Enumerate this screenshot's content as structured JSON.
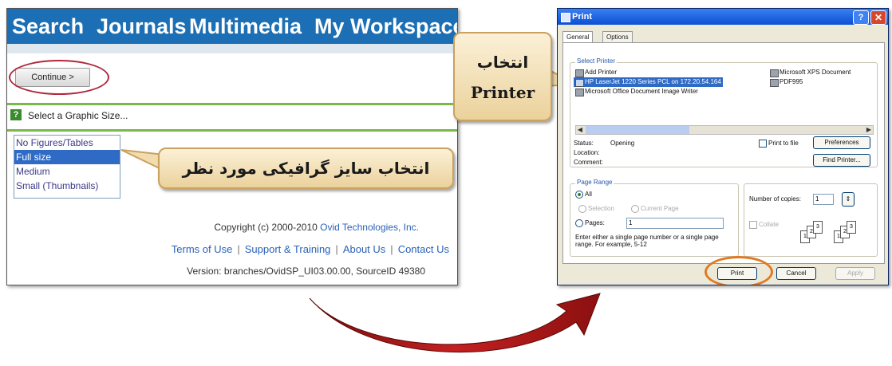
{
  "left_panel": {
    "nav": [
      "Search",
      "Journals",
      "Multimedia",
      "My Workspace"
    ],
    "continue_label": "Continue >",
    "size_prompt": "Select a Graphic Size...",
    "size_options": [
      "No Figures/Tables",
      "Full size",
      "Medium",
      "Small (Thumbnails)"
    ],
    "selected_size_index": 1,
    "footer": {
      "copyright_prefix": "Copyright (c) 2000-2010 ",
      "copyright_company": "Ovid Technologies, Inc.",
      "links": [
        "Terms of Use",
        "Support & Training",
        "About Us",
        "Contact Us"
      ],
      "separator": "|",
      "version": "Version: branches/OvidSP_UI03.00.00, SourceID 49380"
    }
  },
  "callouts": {
    "size": "انتخاب سایز گرافیکی مورد نظر",
    "printer_line1": "انتخاب",
    "printer_line2": "Printer"
  },
  "print_dialog": {
    "title": "Print",
    "help_glyph": "?",
    "close_glyph": "✕",
    "tabs": [
      "General",
      "Options"
    ],
    "select_printer_label": "Select Printer",
    "printers_left": [
      "Add Printer",
      "HP LaserJet 1220 Series PCL on 172.20.54.164",
      "Microsoft Office Document Image Writer"
    ],
    "printers_right": [
      "Microsoft XPS Document",
      "PDF995"
    ],
    "selected_printer_index": 1,
    "status_label": "Status:",
    "status_value": "Opening",
    "location_label": "Location:",
    "comment_label": "Comment:",
    "print_to_file": "Print to file",
    "preferences": "Preferences",
    "find_printer": "Find Printer...",
    "page_range_label": "Page Range",
    "range_all": "All",
    "range_selection": "Selection",
    "range_current": "Current Page",
    "range_pages": "Pages:",
    "pages_value": "1",
    "range_help": "Enter either a single page number or a single page range.  For example, 5-12",
    "copies_label": "Number of copies:",
    "copies_value": "1",
    "collate": "Collate",
    "collate_pages": [
      "1",
      "2",
      "3"
    ],
    "buttons": {
      "print": "Print",
      "cancel": "Cancel",
      "apply": "Apply"
    }
  },
  "colors": {
    "nav_blue": "#1c6fb4",
    "ring_red": "#b0283c",
    "ring_orange": "#e07a24",
    "arrow_red": "#b01818",
    "callout_fill": "#f3e2b8"
  }
}
